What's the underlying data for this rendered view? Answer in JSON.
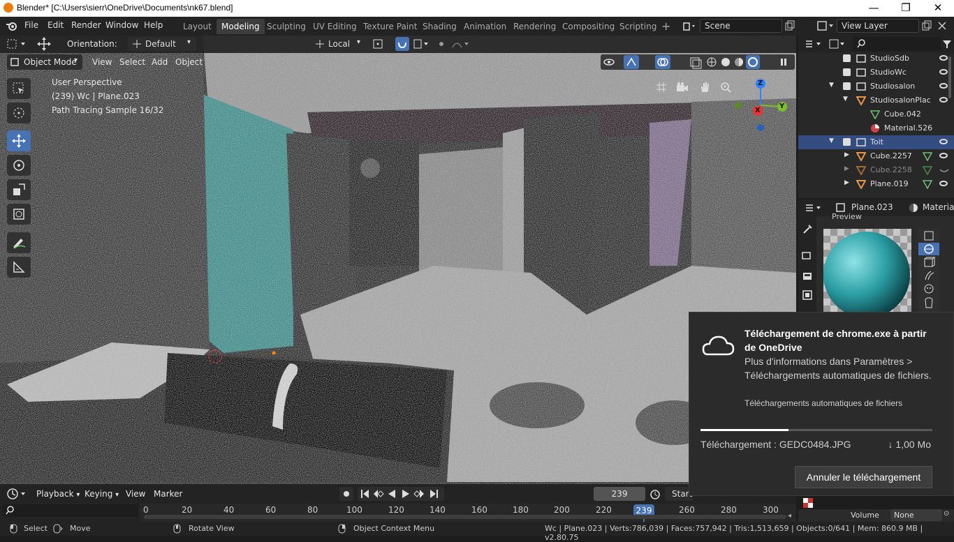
{
  "window": {
    "title": "Blender* [C:\\Users\\sierr\\OneDrive\\Documents\\nk67.blend]",
    "minimize": "—",
    "maximize": "❐",
    "close": "✕"
  },
  "menu": [
    "File",
    "Edit",
    "Render",
    "Window",
    "Help"
  ],
  "workspaces": [
    {
      "label": "Layout",
      "active": false
    },
    {
      "label": "Modeling",
      "active": true
    },
    {
      "label": "Sculpting",
      "active": false
    },
    {
      "label": "UV Editing",
      "active": false
    },
    {
      "label": "Texture Paint",
      "active": false
    },
    {
      "label": "Shading",
      "active": false
    },
    {
      "label": "Animation",
      "active": false
    },
    {
      "label": "Rendering",
      "active": false
    },
    {
      "label": "Compositing",
      "active": false
    },
    {
      "label": "Scripting",
      "active": false
    }
  ],
  "add_workspace": "+",
  "scene": "Scene",
  "view_layer": "View Layer",
  "tool_header": {
    "orientation_label": "Orientation:",
    "orientation_value": "Default",
    "pivot": "Local"
  },
  "viewport_header": {
    "mode": "Object Mode",
    "menus": [
      "View",
      "Select",
      "Add",
      "Object"
    ]
  },
  "viewport_overlay": {
    "line1": "User Perspective",
    "line2": "(239) Wc | Plane.023",
    "line3": "Path Tracing Sample 16/32"
  },
  "gizmo": {
    "z": "Z",
    "x": "X",
    "y": "Y"
  },
  "outliner": {
    "rows": [
      {
        "label": "StudioSdb",
        "selected": false
      },
      {
        "label": "StudioWc",
        "selected": false
      },
      {
        "label": "Studiosalon",
        "selected": false
      },
      {
        "label": "StudiosalonPlac",
        "selected": false
      },
      {
        "label": "Cube.042",
        "selected": false
      },
      {
        "label": "Material.526",
        "selected": false
      },
      {
        "label": "Toit",
        "selected": true
      },
      {
        "label": "Cube.2257",
        "selected": false
      },
      {
        "label": "Cube.2258",
        "selected": false
      },
      {
        "label": "Plane.019",
        "selected": false
      }
    ]
  },
  "properties": {
    "object": "Plane.023",
    "tab": "Material",
    "section": "Preview",
    "volume_label": "Volume",
    "volume_value": "None"
  },
  "timeline": {
    "menus": [
      "Playback",
      "Keying",
      "View",
      "Marker"
    ],
    "current_frame": "239",
    "start_label": "Start",
    "ticks": [
      "0",
      "20",
      "40",
      "60",
      "80",
      "100",
      "120",
      "140",
      "160",
      "180",
      "200",
      "220",
      "239",
      "260",
      "280",
      "300"
    ]
  },
  "status": {
    "select": "Select",
    "move": "Move",
    "rotate": "Rotate View",
    "context": "Object Context Menu",
    "stats": "Wc | Plane.023 | Verts:786,039 | Faces:757,942 | Tris:1,513,659 | Objects:0/641 | Mem: 860.9 MB | v2.80.75"
  },
  "toast": {
    "title": "Téléchargement de chrome.exe à partir de OneDrive",
    "body": "Plus d'informations dans Paramètres > Téléchargements automatiques de fichiers.",
    "link": "Téléchargements automatiques de fichiers",
    "progress": 0.38,
    "file": "Téléchargement : GEDC0484.JPG",
    "size": "↓ 1,00 Mo",
    "cancel": "Annuler le téléchargement"
  },
  "colors": {
    "accent": "#4772b3",
    "selected_row": "#334d80",
    "current_frame": "#4772b3",
    "toast_bg": "#2b2b2b"
  }
}
